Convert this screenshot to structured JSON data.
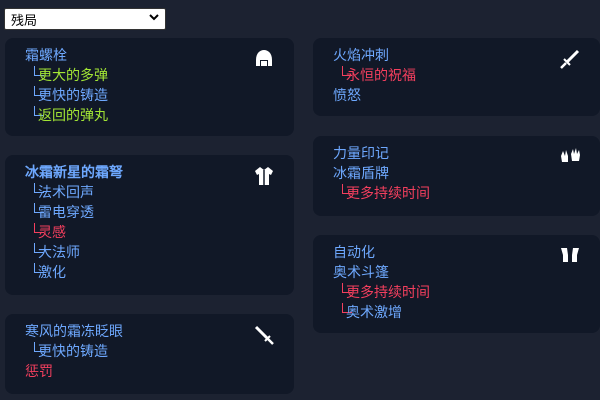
{
  "filter": {
    "selected": "残局"
  },
  "colors": {
    "bg": "#1c2231",
    "card": "#111827",
    "blue": "#6ea8fe",
    "green": "#a3e635",
    "red": "#f43f5e"
  },
  "cards": {
    "c1": {
      "icon": "helmet-icon",
      "title": "霜螺栓",
      "items": [
        "更大的多弹",
        "更快的铸造",
        "返回的弹丸"
      ]
    },
    "c2": {
      "icon": "tunic-icon",
      "title": "冰霜新星的霜弩",
      "items": [
        "法术回声",
        "雷电穿透",
        "灵感",
        "大法师",
        "激化"
      ]
    },
    "c3": {
      "icon": "sword-icon",
      "title": "寒风的霜冻眨眼",
      "items": [
        "更快的铸造"
      ],
      "extra": "惩罚"
    },
    "c4": {
      "icon": "sword-icon",
      "title": "火焰冲刺",
      "items": [
        "永恒的祝福"
      ],
      "extra": "愤怒"
    },
    "c5": {
      "icon": "gloves-icon",
      "title": "力量印记",
      "sub": "冰霜盾牌",
      "items": [
        "更多持续时间"
      ]
    },
    "c6": {
      "icon": "boots-icon",
      "title": "自动化",
      "sub": "奥术斗篷",
      "items": [
        "更多持续时间",
        "奥术激增"
      ]
    }
  }
}
